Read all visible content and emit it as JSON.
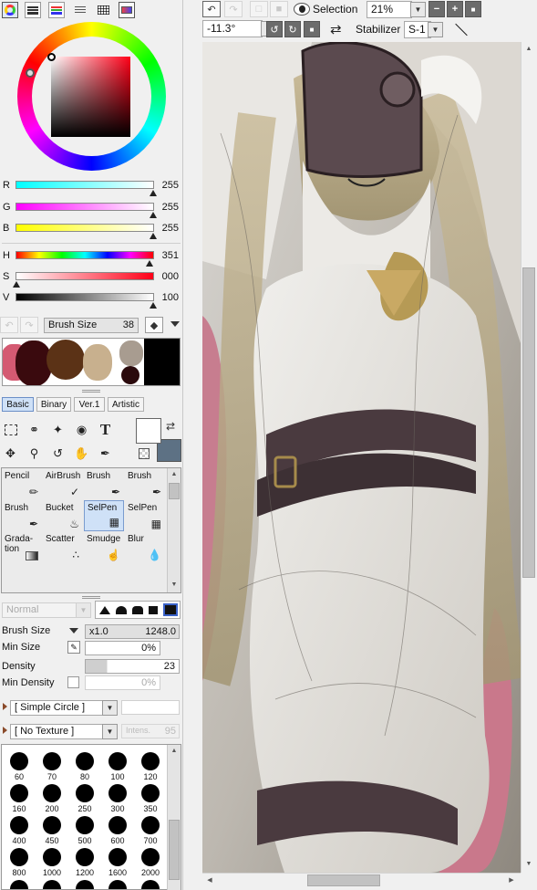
{
  "top_bar": {
    "panel_tabs": [
      "color-wheel-icon",
      "rgb-slider-icon",
      "hsv-slider-icon",
      "list-icon",
      "swatch-grid-icon",
      "scratchpad-icon"
    ],
    "selection_label": "Selection",
    "zoom": "21%",
    "rotation": "-11.3°",
    "stabilizer_label": "Stabilizer",
    "stabilizer_value": "S-1"
  },
  "color": {
    "current_hex": "#ff0018",
    "sliders": [
      {
        "label": "R",
        "value": "255",
        "level": 1.0
      },
      {
        "label": "G",
        "value": "255",
        "level": 1.0
      },
      {
        "label": "B",
        "value": "255",
        "level": 1.0
      },
      {
        "label": "H",
        "value": "351",
        "level": 0.975
      },
      {
        "label": "S",
        "value": "000",
        "level": 0.0
      },
      {
        "label": "V",
        "value": "100",
        "level": 1.0
      }
    ]
  },
  "brush_size_bar": {
    "label": "Brush Size",
    "value": "38"
  },
  "tool_tabs": [
    "Basic",
    "Binary",
    "Ver.1",
    "Artistic"
  ],
  "brush_tools": [
    {
      "label": "Pencil",
      "icon": "pencil-icon"
    },
    {
      "label": "AirBrush",
      "icon": "airbrush-icon"
    },
    {
      "label": "Brush",
      "icon": "brush-icon"
    },
    {
      "label": "Brush",
      "icon": "brush-icon"
    },
    {
      "label": "Brush",
      "icon": "brush-icon"
    },
    {
      "label": "Bucket",
      "icon": "bucket-icon"
    },
    {
      "label": "SelPen",
      "icon": "selpen-icon"
    },
    {
      "label": "SelPen",
      "icon": "selpen-icon"
    },
    {
      "label": "Grada-\ntion",
      "icon": "gradation-icon"
    },
    {
      "label": "Scatter",
      "icon": "scatter-icon"
    },
    {
      "label": "Smudge",
      "icon": "smudge-icon"
    },
    {
      "label": "Blur",
      "icon": "blur-icon"
    }
  ],
  "blend_mode": "Normal",
  "brush_settings": {
    "size_label": "Brush Size",
    "size_multiplier": "x1.0",
    "size_value": "1248.0",
    "min_size_label": "Min Size",
    "min_size_value": "0%",
    "density_label": "Density",
    "density_value": "23",
    "min_density_label": "Min Density",
    "min_density_value": "0%",
    "shape": "[ Simple Circle ]",
    "texture": "[ No Texture ]",
    "intensity_label": "Intens.",
    "intensity_value": "95"
  },
  "brush_sizes": [
    "60",
    "70",
    "80",
    "100",
    "120",
    "160",
    "200",
    "250",
    "300",
    "350",
    "400",
    "450",
    "500",
    "600",
    "700",
    "800",
    "1000",
    "1200",
    "1600",
    "2000"
  ]
}
